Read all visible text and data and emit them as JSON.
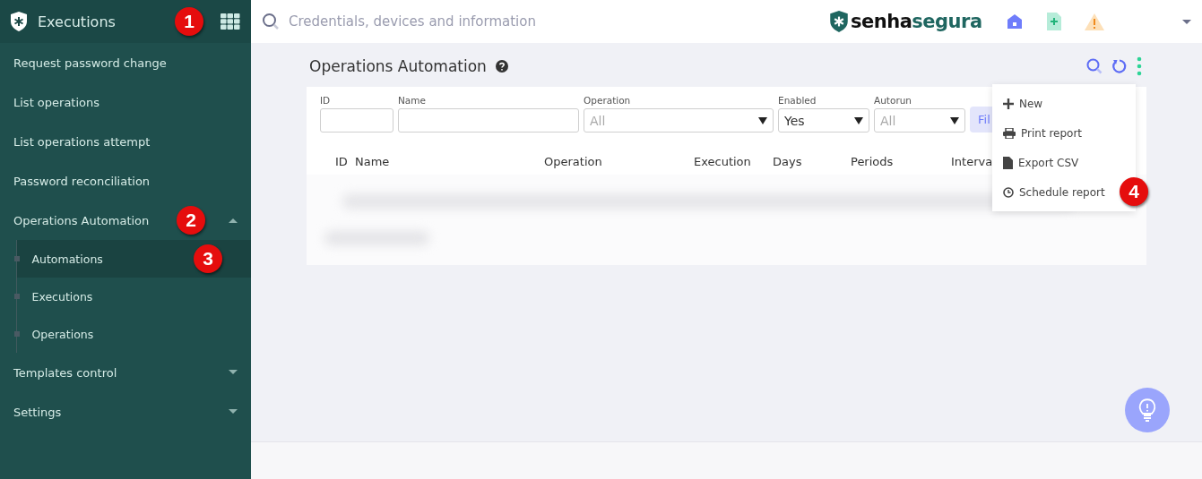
{
  "sidebar": {
    "title": "Executions",
    "callout": "1",
    "items": [
      {
        "kind": "link",
        "label": "Request password change"
      },
      {
        "kind": "link",
        "label": "List operations"
      },
      {
        "kind": "link",
        "label": "List operations attempt"
      },
      {
        "kind": "link",
        "label": "Password reconciliation"
      },
      {
        "kind": "group",
        "label": "Operations Automation",
        "expanded": true,
        "callout": "2",
        "children": [
          {
            "label": "Automations",
            "selected": true,
            "callout": "3"
          },
          {
            "label": "Executions",
            "selected": false
          },
          {
            "label": "Operations",
            "selected": false
          }
        ]
      },
      {
        "kind": "group",
        "label": "Templates control",
        "expanded": false
      },
      {
        "kind": "group",
        "label": "Settings",
        "expanded": false
      }
    ]
  },
  "topbar": {
    "search": {
      "placeholder": "Credentials, devices and information"
    },
    "logo": {
      "dark": "senha",
      "accent": "segura"
    }
  },
  "page": {
    "title": "Operations Automation",
    "filters": [
      {
        "kind": "input",
        "label": "ID"
      },
      {
        "kind": "input",
        "label": "Name"
      },
      {
        "kind": "select",
        "label": "Operation",
        "placeholder": "All"
      },
      {
        "kind": "select",
        "label": "Enabled",
        "value": "Yes"
      },
      {
        "kind": "select",
        "label": "Autorun",
        "placeholder": "All"
      }
    ],
    "filter_button": "Fil",
    "columns": [
      "ID",
      "Name",
      "Operation",
      "Execution",
      "Days",
      "Periods",
      "Interva"
    ],
    "menu": [
      {
        "label": "New"
      },
      {
        "label": "Print report"
      },
      {
        "label": "Export CSV"
      },
      {
        "label": "Schedule report",
        "callout": "4"
      }
    ]
  }
}
